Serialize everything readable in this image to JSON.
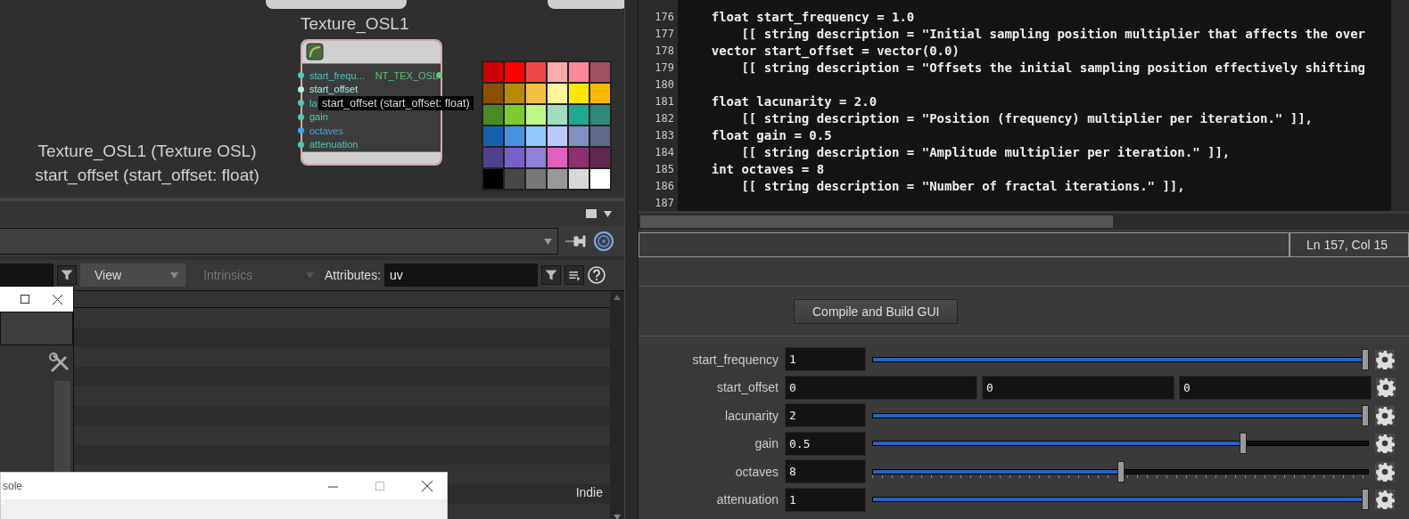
{
  "network": {
    "node": {
      "title": "Texture_OSL1",
      "output": "NT_TEX_OSL",
      "inputs": [
        {
          "name": "start_frequ...",
          "color": "#4fc8b8"
        },
        {
          "name": "start_offset",
          "color": "#a8f0f0"
        },
        {
          "name": "la",
          "color": "#4fc8b8"
        },
        {
          "name": "gain",
          "color": "#4fc8b8"
        },
        {
          "name": "octaves",
          "color": "#3aa8f0"
        },
        {
          "name": "attenuation",
          "color": "#4fc8b8"
        }
      ]
    },
    "tooltip": "start_offset (start_offset: float)",
    "info": [
      "Texture_OSL1 (Texture OSL)",
      "start_offset (start_offset: float)"
    ],
    "palette": [
      {
        "color": "#cc0000"
      },
      {
        "color": "#ff0000"
      },
      {
        "color": "#f04848"
      },
      {
        "color": "#ffaaaa"
      },
      {
        "color": "#ff8899"
      },
      {
        "color": "#a05060"
      },
      {
        "color": "#8b5000"
      },
      {
        "color": "#b88a00"
      },
      {
        "color": "#f8c040"
      },
      {
        "color": "#fff59a"
      },
      {
        "color": "#ffe800"
      },
      {
        "color": "#ffb800"
      },
      {
        "color": "#4a8a20"
      },
      {
        "color": "#7ccc30"
      },
      {
        "color": "#c0f888"
      },
      {
        "color": "#a0dcc0"
      },
      {
        "color": "#20a890"
      },
      {
        "color": "#308878"
      },
      {
        "color": "#1860b0"
      },
      {
        "color": "#4a90e0"
      },
      {
        "color": "#90c8ff"
      },
      {
        "color": "#b8c8ff"
      },
      {
        "color": "#8090c0"
      },
      {
        "color": "#606888"
      },
      {
        "color": "#504090"
      },
      {
        "color": "#7860c8"
      },
      {
        "color": "#9080d8"
      },
      {
        "color": "#e060c0"
      },
      {
        "color": "#903070"
      },
      {
        "color": "#602850"
      },
      {
        "color": "#000000"
      },
      {
        "color": "#484848"
      },
      {
        "color": "#787878"
      },
      {
        "color": "#989898"
      },
      {
        "color": "#d8d8d8"
      },
      {
        "color": "#ffffff"
      }
    ]
  },
  "spreadsheet": {
    "toolbar": {
      "view": "View",
      "intrinsics": {
        "label": "Intrinsics",
        "disabled": true
      },
      "attributes_label": "Attributes:",
      "attributes_value": "uv"
    },
    "badge": "Indie"
  },
  "console_window": {
    "title": "sole"
  },
  "editor": {
    "lines": [
      {
        "number": "176",
        "code": "    float start_frequency = 1.0"
      },
      {
        "number": "177",
        "code": "        [[ string description = \"Initial sampling position multiplier that affects the over"
      },
      {
        "number": "178",
        "code": "    vector start_offset = vector(0.0)"
      },
      {
        "number": "179",
        "code": "        [[ string description = \"Offsets the initial sampling position effectively shifting"
      },
      {
        "number": "180"
      },
      {
        "number": "181",
        "code": "    float lacunarity = 2.0"
      },
      {
        "number": "182",
        "code": "        [[ string description = \"Position (frequency) multiplier per iteration.\" ]],"
      },
      {
        "number": "183",
        "code": "    float gain = 0.5"
      },
      {
        "number": "184",
        "code": "        [[ string description = \"Amplitude multiplier per iteration.\" ]],"
      },
      {
        "number": "185",
        "code": "    int octaves = 8"
      },
      {
        "number": "186",
        "code": "        [[ string description = \"Number of fractal iterations.\" ]],"
      },
      {
        "number": "187"
      }
    ],
    "status": "Ln 157, Col 15"
  },
  "parameters": {
    "button": "Compile and Build GUI",
    "rows": [
      {
        "kind": "slider",
        "label": "start_frequency",
        "value": "1",
        "level": 1
      },
      {
        "kind": "vector",
        "label": "start_offset",
        "values": [
          "0",
          "0",
          "0"
        ]
      },
      {
        "kind": "slider",
        "label": "lacunarity",
        "value": "2",
        "level": 1
      },
      {
        "kind": "slider",
        "label": "gain",
        "value": "0.5",
        "level": 0.75
      },
      {
        "kind": "int_slider",
        "label": "octaves",
        "value": "8",
        "level": 0.5
      },
      {
        "kind": "slider",
        "label": "attenuation",
        "value": "1",
        "level": 1
      }
    ]
  }
}
